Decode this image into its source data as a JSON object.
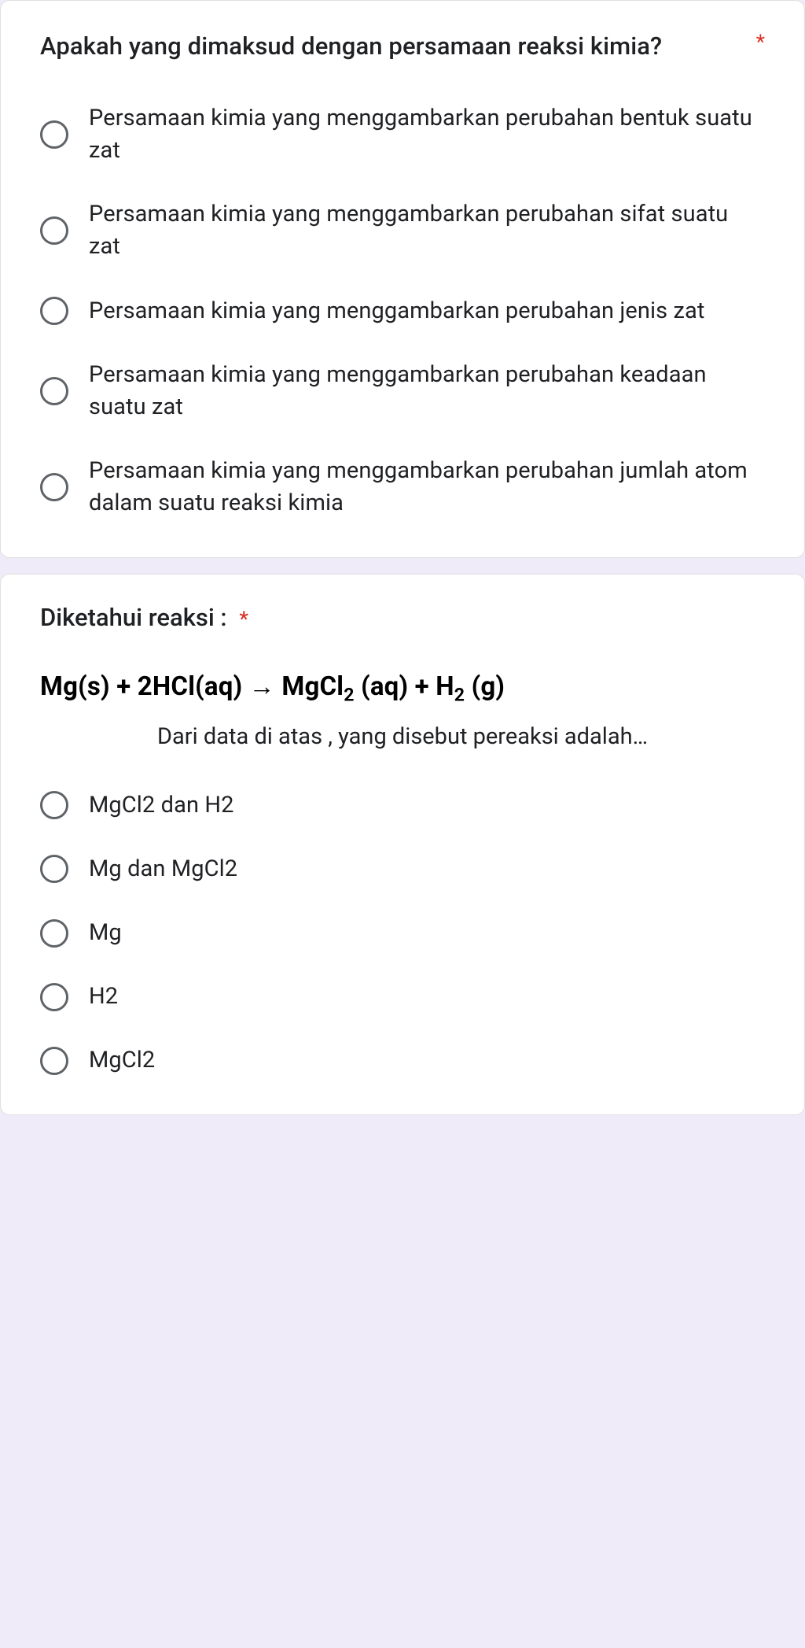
{
  "required_marker": "*",
  "question1": {
    "title": "Apakah yang dimaksud dengan persamaan reaksi kimia?",
    "options": [
      "Persamaan kimia yang menggambarkan perubahan bentuk suatu zat",
      "Persamaan kimia yang menggambarkan perubahan sifat suatu zat",
      "Persamaan kimia yang menggambarkan perubahan jenis zat",
      "Persamaan kimia yang menggambarkan perubahan keadaan suatu zat",
      "Persamaan kimia yang menggambarkan perubahan jumlah atom dalam suatu reaksi kimia"
    ]
  },
  "question2": {
    "title": "Diketahui reaksi :",
    "equation_plain": "Mg(s) + 2HCl(aq) → MgCl2 (aq) + H2 (g)",
    "subtext": "Dari data di atas , yang disebut pereaksi adalah…",
    "options": [
      "MgCl2 dan H2",
      "Mg dan MgCl2",
      "Mg",
      "H2",
      "MgCl2"
    ]
  }
}
